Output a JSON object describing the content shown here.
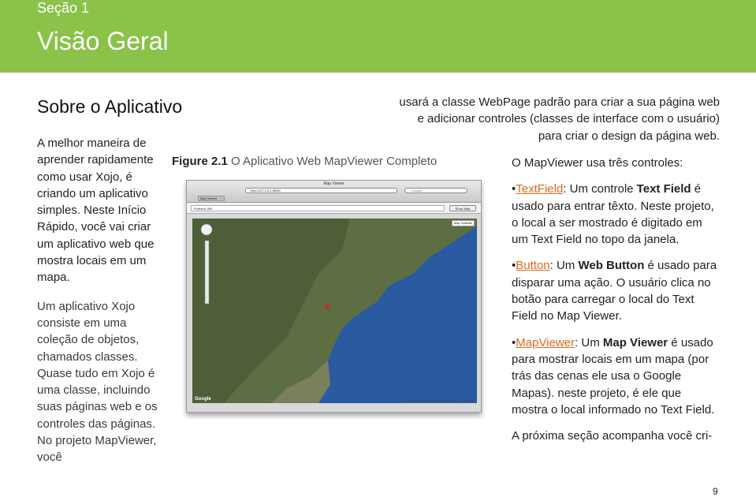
{
  "header": {
    "section": "Seção 1",
    "title": "Visão Geral"
  },
  "subhead": "Sobre o Aplicativo",
  "left_col": {
    "p1": "A melhor maneira de aprender rapidamente como usar Xojo, é criando um aplicativo simples. Neste Início Rápido, você vai criar um aplicativo web que mostra locais em um mapa.",
    "p2": "Um aplicativo Xojo consiste em uma coleção de objetos, chamados classes. Quase tudo em Xojo é uma classe, incluindo suas páginas web e os controles das páginas. No projeto MapViewer, você"
  },
  "figure": {
    "label": "Figure 2.1",
    "caption": "O Aplicativo Web MapViewer Completo",
    "window_title": "Map Viewer",
    "url": "http://127.0.0.1:8080/",
    "search": "Google",
    "tab": "Map Viewer",
    "field_value": "Portland, ME",
    "button": "Show Map",
    "map_types": "Map  Satellite",
    "google": "Google",
    "copyright": "Map data ©2013 Google Imagery ©2013 TerraMetrics · Terms of Use"
  },
  "top_text": "usará a classe WebPage padrão para criar a sua página web e adicionar controles (classes de interface com o usuário) para criar o design da página web.",
  "right_col": {
    "intro": "O MapViewer usa três controles:",
    "b1": {
      "bullet": "•",
      "link": "TextField",
      "sep": ": Um controle ",
      "bold": "Text Field",
      "rest": " é usado para entrar têxto. Neste projeto, o local a ser mostrado é digitado em um Text Field no topo da janela."
    },
    "b2": {
      "bullet": "•",
      "link": "Button",
      "sep": ": Um ",
      "bold": "Web Button",
      "rest": " é usado para disparar uma ação. O usuário clica no botão para carregar o local do Text Field no Map Viewer."
    },
    "b3": {
      "bullet": "•",
      "link": "MapViewer",
      "sep": ": Um ",
      "bold": "Map Viewer",
      "rest": " é usado para mostrar locais em um mapa (por trás das cenas ele usa o Google Mapas). neste projeto, é ele que mostra o local informado no Text Field."
    },
    "outro": "A próxima seção acompanha você cri-"
  },
  "page_number": "9",
  "colors": {
    "header": "#8ac24a",
    "link": "#e06a1e"
  }
}
